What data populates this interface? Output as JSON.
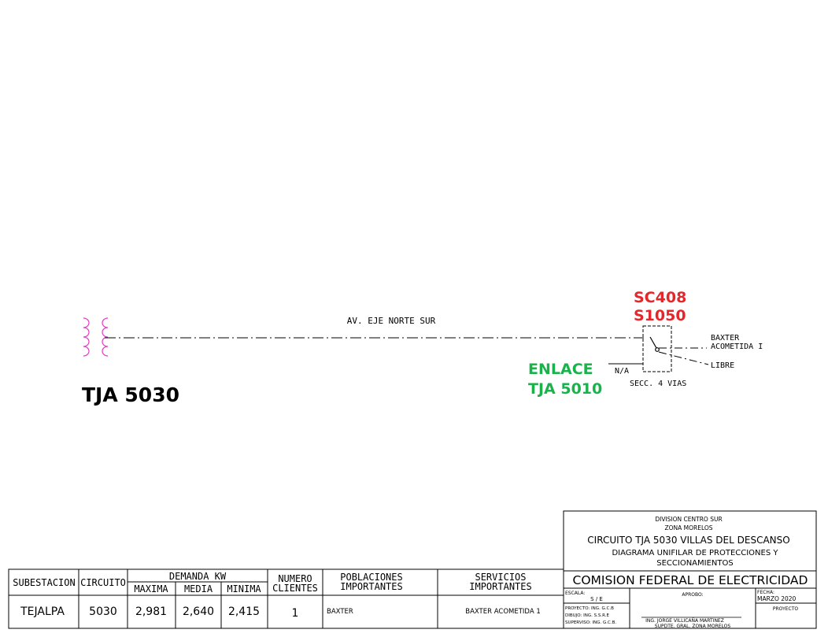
{
  "diagram": {
    "line_label": "AV. EJE NORTE SUR",
    "substation_label": "TJA 5030",
    "switch_ids": [
      "SC408",
      "S1050"
    ],
    "link_label": [
      "ENLACE",
      "TJA 5010"
    ],
    "na_label": "N/A",
    "switch_desc": "SECC. 4 VIAS",
    "out1_label": [
      "BAXTER",
      "ACOMETIDA I"
    ],
    "out2_label": "LIBRE",
    "colors": {
      "ids": "#e5262b",
      "link": "#19b24b",
      "source": "#e040c0"
    }
  },
  "table": {
    "headers": {
      "subestacion": "SUBESTACION",
      "circuito": "CIRCUITO",
      "demanda": "DEMANDA KW",
      "maxima": "MAXIMA",
      "media": "MEDIA",
      "minima": "MINIMA",
      "numero": "NUMERO",
      "clientes": "CLIENTES",
      "poblaciones": "POBLACIONES",
      "poblaciones2": "IMPORTANTES",
      "servicios": "SERVICIOS",
      "servicios2": "IMPORTANTES"
    },
    "row": {
      "subestacion": "TEJALPA",
      "circuito": "5030",
      "maxima": "2,981",
      "media": "2,640",
      "minima": "2,415",
      "clientes": "1",
      "poblaciones": "BAXTER",
      "servicios": "BAXTER ACOMETIDA 1"
    }
  },
  "title_block": {
    "division": "DIVISION CENTRO SUR",
    "zona": "ZONA MORELOS",
    "circuit": "CIRCUITO TJA 5030 VILLAS DEL DESCANSO",
    "subtitle1": "DIAGRAMA UNIFILAR DE PROTECCIONES Y",
    "subtitle2": "SECCIONAMIENTOS",
    "company": "COMISION FEDERAL DE ELECTRICIDAD",
    "escala_label": "ESCALA:",
    "escala_value": "S / E",
    "aprobo_label": "APROBO:",
    "fecha_label": "FECHA:",
    "fecha_value": "MARZO 2020",
    "proyecto_label": "PROYECTO",
    "proyecto_line": "PROYECTO: ING. G.C.B",
    "dibujo_line": "DIBUJO:   ING. S.S.R.E",
    "superviso_line": "SUPERVISO: ING. G.C.B.",
    "approver_name": "ING. JORGE VILLICAÑA MARTINEZ",
    "approver_title": "SUPDTE. GRAL. ZONA MORELOS"
  }
}
